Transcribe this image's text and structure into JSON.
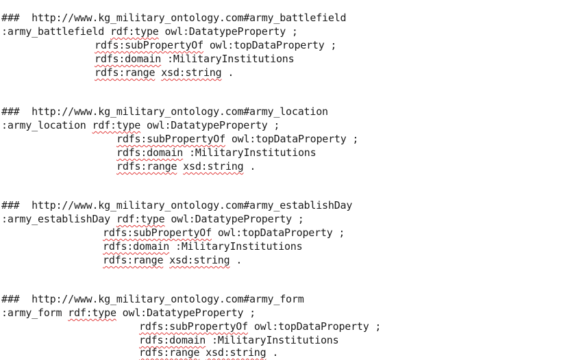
{
  "blocks": [
    {
      "comment": "###  http://www.kg_military_ontology.com#army_battlefield",
      "subject": ":army_battlefield",
      "type_kw": "rdf:type",
      "type_val": "owl:DatatypeProperty ;",
      "sub_kw": "rdfs:subPropertyOf",
      "sub_val": "owl:topDataProperty ;",
      "dom_kw": "rdfs:domain",
      "dom_val": ":MilitaryInstitutions",
      "rng_kw": "rdfs:range",
      "rng_type": "xsd:string",
      "rng_end": "."
    },
    {
      "comment": "###  http://www.kg_military_ontology.com#army_location",
      "subject": ":army_location",
      "type_kw": "rdf:type",
      "type_val": "owl:DatatypeProperty ;",
      "sub_kw": "rdfs:subPropertyOf",
      "sub_val": "owl:topDataProperty ;",
      "dom_kw": "rdfs:domain",
      "dom_val": ":MilitaryInstitutions",
      "rng_kw": "rdfs:range",
      "rng_type": "xsd:string",
      "rng_end": "."
    },
    {
      "comment": "###  http://www.kg_military_ontology.com#army_establishDay",
      "subject": ":army_establishDay",
      "type_kw": "rdf:type",
      "type_val": "owl:DatatypeProperty ;",
      "sub_kw": "rdfs:subPropertyOf",
      "sub_val": "owl:topDataProperty ;",
      "dom_kw": "rdfs:domain",
      "dom_val": ":MilitaryInstitutions",
      "rng_kw": "rdfs:range",
      "rng_type": "xsd:string",
      "rng_end": "."
    },
    {
      "comment": "###  http://www.kg_military_ontology.com#army_form",
      "subject": ":army_form",
      "type_kw": "rdf:type",
      "type_val": "owl:DatatypeProperty ;",
      "sub_kw": "rdfs:subPropertyOf",
      "sub_val": "owl:topDataProperty ;",
      "dom_kw": "rdfs:domain",
      "dom_val": ":MilitaryInstitutions",
      "rng_kw": "rdfs:range",
      "rng_type": "xsd:string",
      "rng_end": "."
    }
  ],
  "colors": {
    "text": "#1a1a1a",
    "spellcheck": "#e23b3b",
    "background": "#ffffff"
  }
}
